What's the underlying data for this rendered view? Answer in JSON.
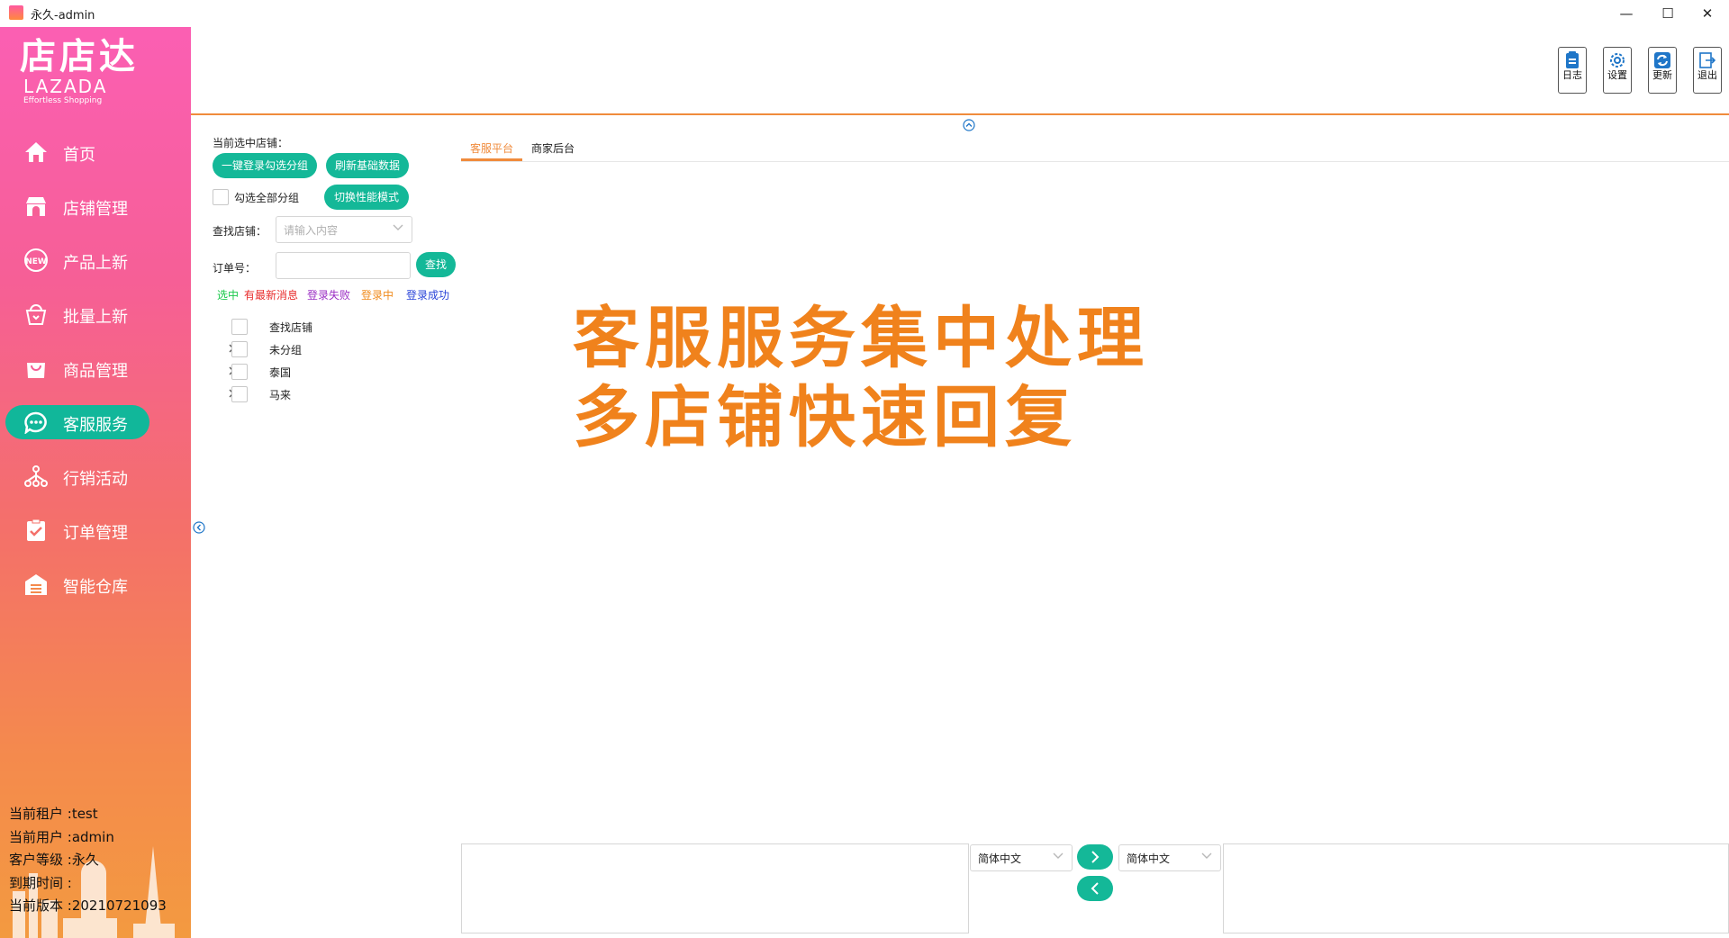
{
  "window": {
    "title": "永久-admin",
    "controls": [
      "—",
      "☐",
      "✕"
    ]
  },
  "logo": {
    "cn": "店店达",
    "en": "LAZADA",
    "sub": "Effortless Shopping"
  },
  "sidebar": {
    "items": [
      {
        "label": "首页",
        "icon": "home-icon"
      },
      {
        "label": "店铺管理",
        "icon": "store-icon"
      },
      {
        "label": "产品上新",
        "icon": "new-badge-icon"
      },
      {
        "label": "批量上新",
        "icon": "basket-icon"
      },
      {
        "label": "商品管理",
        "icon": "shopping-bag-icon"
      },
      {
        "label": "客服服务",
        "icon": "chat-icon",
        "active": true
      },
      {
        "label": "行销活动",
        "icon": "network-icon"
      },
      {
        "label": "订单管理",
        "icon": "clipboard-check-icon"
      },
      {
        "label": "智能仓库",
        "icon": "warehouse-icon"
      }
    ],
    "accent": "#11b79a"
  },
  "user_info": {
    "tenant": "当前租户 :test",
    "user": "当前用户 :admin",
    "level": "客户等级 :永久",
    "expiry": "到期时间 :",
    "version": "当前版本 :20210721093"
  },
  "toolbar": {
    "log": "日志",
    "settings": "设置",
    "update": "更新",
    "exit": "退出"
  },
  "panel": {
    "current_shop_label": "当前选中店铺：",
    "login_group_btn": "一键登录勾选分组",
    "refresh_btn": "刷新基础数据",
    "select_all_label": "勾选全部分组",
    "switch_mode_btn": "切换性能模式",
    "find_shop_label": "查找店铺：",
    "find_shop_placeholder": "请输入内容",
    "order_label": "订单号：",
    "order_value": "",
    "search_btn": "查找"
  },
  "legend": [
    {
      "text": "选中",
      "color": "#19c84a"
    },
    {
      "text": "有最新消息",
      "color": "#e82c2c"
    },
    {
      "text": "登录失败",
      "color": "#9b2fc4"
    },
    {
      "text": "登录中",
      "color": "#f08b1c"
    },
    {
      "text": "登录成功",
      "color": "#2a44d8"
    }
  ],
  "tree": {
    "header": "查找店铺",
    "groups": [
      "未分组",
      "泰国",
      "马来"
    ]
  },
  "tabs": [
    {
      "label": "客服平台",
      "active": true
    },
    {
      "label": "商家后台",
      "active": false
    }
  ],
  "promo": {
    "line1": "客服服务集中处理",
    "line2": "多店铺快速回复"
  },
  "translate": {
    "source_lang": "简体中文",
    "target_lang": "简体中文",
    "source_text": "",
    "target_text": ""
  }
}
